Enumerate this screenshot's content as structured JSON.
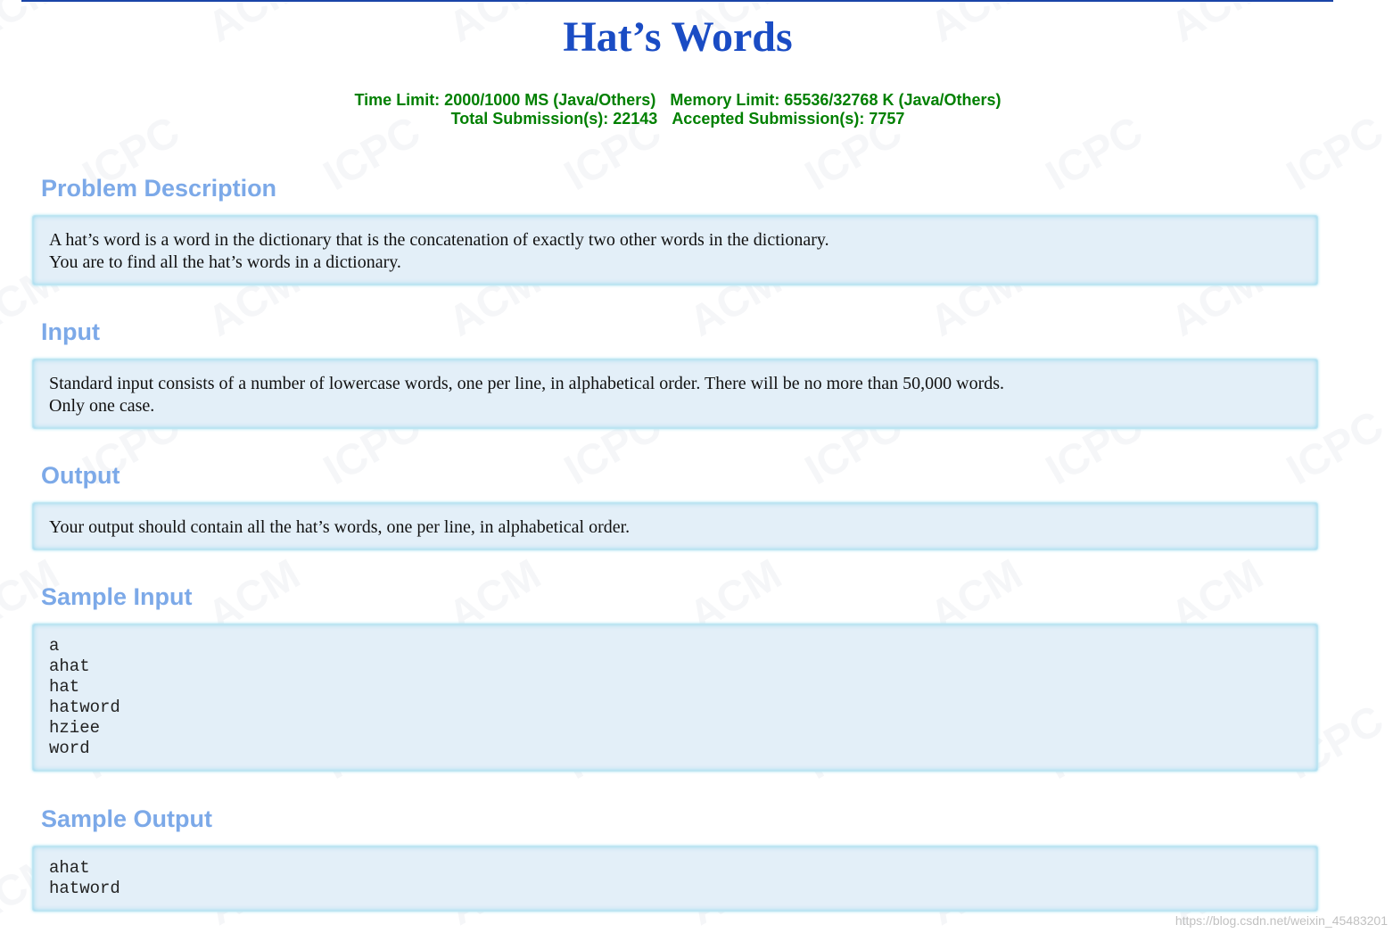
{
  "problem": {
    "title": "Hat’s Words",
    "time_limit": "Time Limit: 2000/1000 MS (Java/Others)",
    "memory_limit": "Memory Limit: 65536/32768 K (Java/Others)",
    "total_submissions": "Total Submission(s): 22143",
    "accepted_submissions": "Accepted Submission(s): 7757"
  },
  "sections": {
    "description": {
      "heading": "Problem Description",
      "line1": "A hat’s word is a word in the dictionary that is the concatenation of exactly two other words in the dictionary.",
      "line2": "You are to find all the hat’s words in a dictionary."
    },
    "input": {
      "heading": "Input",
      "line1": "Standard input consists of a number of lowercase words, one per line, in alphabetical order. There will be no more than 50,000 words.",
      "line2": "Only one case."
    },
    "output": {
      "heading": "Output",
      "line1": "Your output should contain all the hat’s words, one per line, in alphabetical order."
    },
    "sample_input": {
      "heading": "Sample Input",
      "code": "a\nahat\nhat\nhatword\nhziee\nword"
    },
    "sample_output": {
      "heading": "Sample Output",
      "code": "ahat\nhatword"
    }
  },
  "watermark": {
    "acm": "ACM",
    "icpc": "ICPC"
  },
  "credit": "https://blog.csdn.net/weixin_45483201",
  "colors": {
    "title": "#1a4cc4",
    "limits": "#008000",
    "section_heading": "#7ca9e8",
    "panel_bg": "#e3eff8",
    "panel_border": "#bfe6f2"
  }
}
